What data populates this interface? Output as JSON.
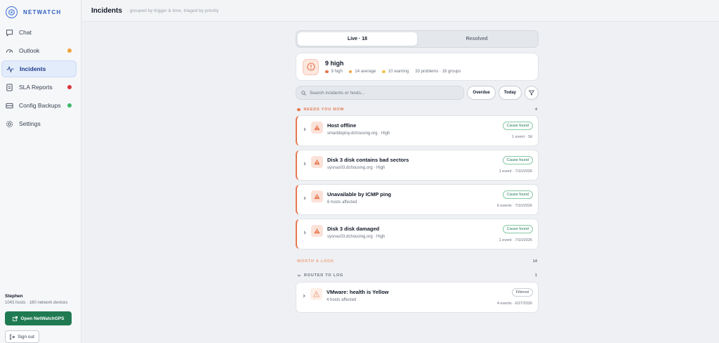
{
  "brand": {
    "name": "NETWATCH"
  },
  "sidebar": {
    "items": [
      {
        "label": "Chat",
        "icon": "chat-bubble-icon",
        "dot": null,
        "active": false
      },
      {
        "label": "Outlook",
        "icon": "gauge-icon",
        "dot": "#f0a23b",
        "active": false
      },
      {
        "label": "Incidents",
        "icon": "activity-icon",
        "dot": null,
        "active": true
      },
      {
        "label": "SLA Reports",
        "icon": "document-icon",
        "dot": "#d9363e",
        "active": false
      },
      {
        "label": "Config Backups",
        "icon": "server-icon",
        "dot": "#3fb86b",
        "active": false
      },
      {
        "label": "Settings",
        "icon": "gear-icon",
        "dot": null,
        "active": false
      }
    ],
    "user": {
      "name": "Stephen",
      "meta": "1043 hosts · 160 network devices"
    },
    "open_button": "Open NetWatchGPS",
    "signout_button": "Sign out"
  },
  "header": {
    "title": "Incidents",
    "subtitle": "· grouped by trigger & time, triaged by priority"
  },
  "tabs": {
    "live": "Live · 18",
    "resolved": "Resolved"
  },
  "summary": {
    "title": "9 high",
    "high": "9 high",
    "average": "14 average",
    "warning": "10 warning",
    "totals": "33 problems · 18 groups"
  },
  "toolbar": {
    "search_placeholder": "Search incidents or hosts...",
    "overdue": "Overdue",
    "today": "Today"
  },
  "sections": {
    "needs": {
      "label": "NEEDS YOU NOW",
      "count": "4",
      "color": "#e6774f"
    },
    "worth": {
      "label": "WORTH A LOOK",
      "count": "14",
      "color": "#f0a07a"
    },
    "routed": {
      "label": "ROUTED TO LOG",
      "count": "1",
      "color": "#6b7280"
    }
  },
  "incidents": [
    {
      "title": "Host offline",
      "sub": "smartdeploy.dchousing.org · High",
      "badge": "Cause found",
      "meta": "1 event · 3d"
    },
    {
      "title": "Disk 3 disk contains bad sectors",
      "sub": "sysnas03.dchousing.org · High",
      "badge": "Cause found",
      "meta": "1 event · 7/10/2026"
    },
    {
      "title": "Unavailable by ICMP ping",
      "sub": "6 hosts affected",
      "badge": "Cause found",
      "meta": "6 events · 7/10/2026"
    },
    {
      "title": "Disk 3 disk damaged",
      "sub": "sysnas03.dchousing.org · High",
      "badge": "Cause found",
      "meta": "1 event · 7/10/2026"
    }
  ],
  "routed": [
    {
      "title": "VMware: health is Yellow",
      "sub": "4 hosts affected",
      "badge": "Filtered",
      "meta": "4 events · 6/27/2026"
    }
  ],
  "colors": {
    "accent": "#3b6fd4",
    "high": "#e6774f",
    "average": "#f0a23b",
    "warning": "#f2c14e",
    "primary_button": "#1f7a52"
  }
}
